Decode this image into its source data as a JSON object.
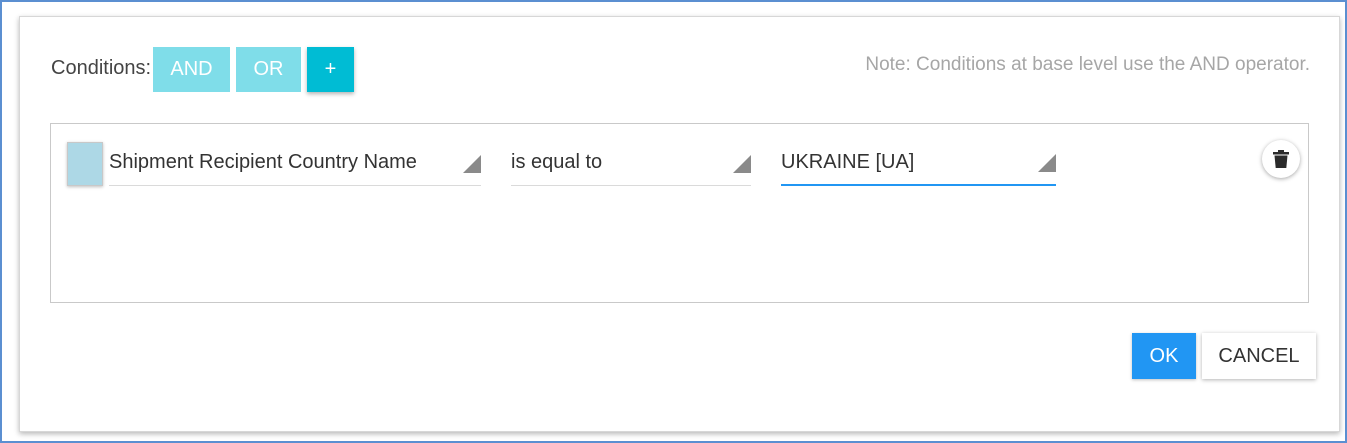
{
  "conditions": {
    "label": "Conditions:",
    "and_label": "AND",
    "or_label": "OR",
    "add_label": "+"
  },
  "note": "Note: Conditions at base level use the AND operator.",
  "rule": {
    "field": "Shipment Recipient Country Name",
    "operator": "is equal to",
    "value": "UKRAINE [UA]",
    "delete_icon": "trash-icon"
  },
  "footer": {
    "ok_label": "OK",
    "cancel_label": "CANCEL"
  },
  "colors": {
    "accent_cyan": "#00bcd4",
    "accent_cyan_light": "#7fdde9",
    "primary_blue": "#2196f3",
    "checkbox_fill": "#add8e6"
  }
}
